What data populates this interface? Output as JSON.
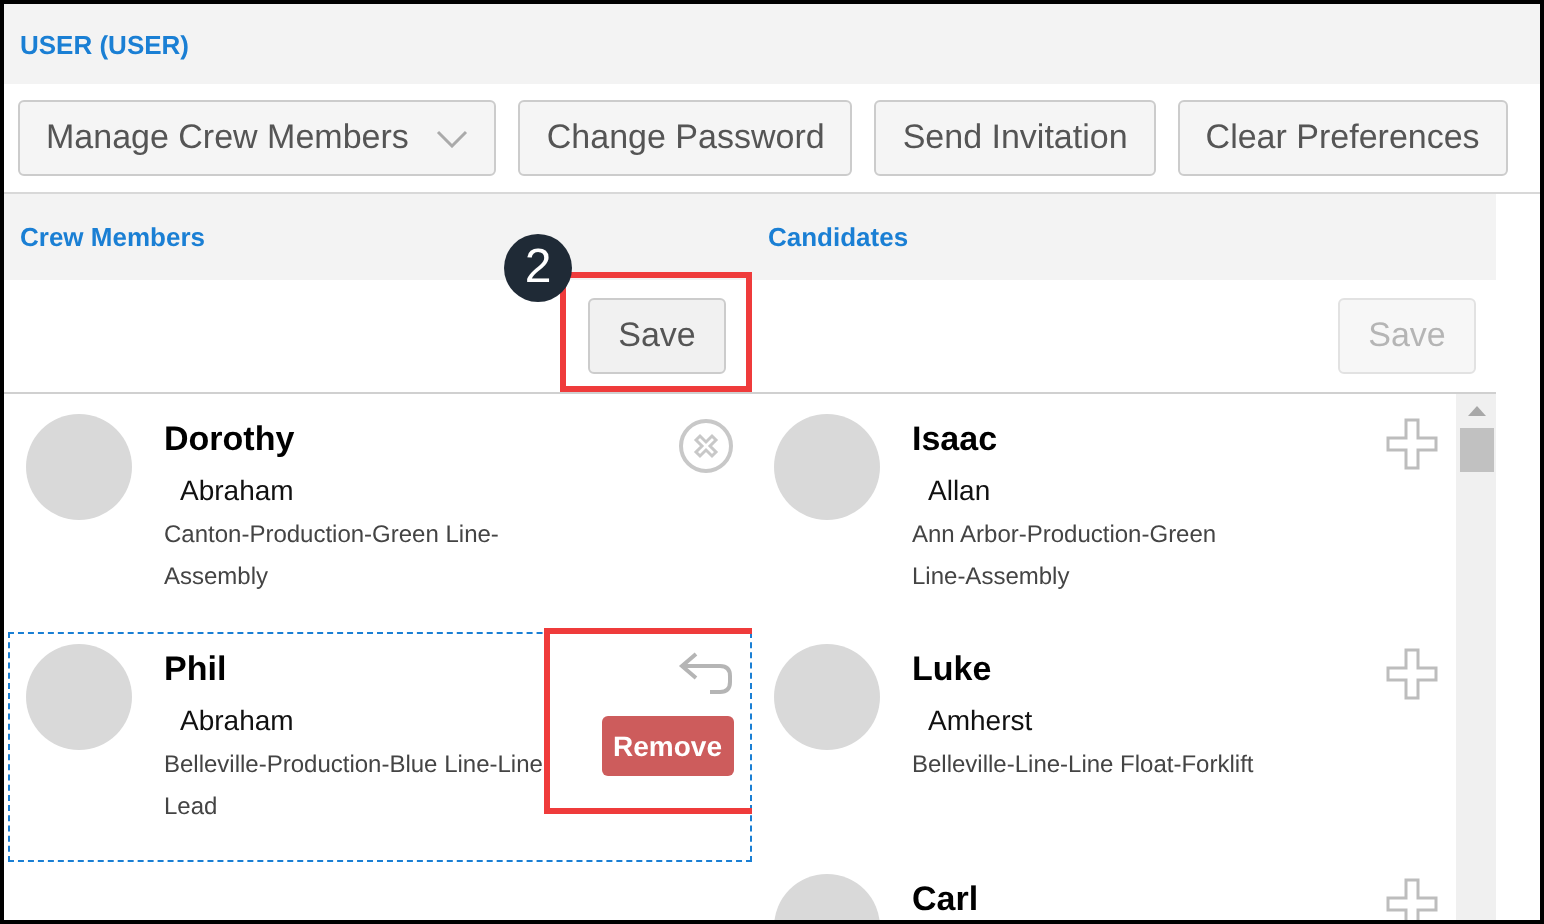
{
  "title": "USER (USER)",
  "toolbar": [
    {
      "kind": "dropdown",
      "label": "Manage Crew Members"
    },
    {
      "kind": "button",
      "label": "Change Password"
    },
    {
      "kind": "button",
      "label": "Send Invitation"
    },
    {
      "kind": "button",
      "label": "Clear Preferences"
    }
  ],
  "step_badge": "2",
  "crew_members": {
    "heading": "Crew Members",
    "save": {
      "label": "Save",
      "disabled": false,
      "highlighted": true
    },
    "items": [
      {
        "first_name": "Dorothy",
        "last_name": "Abraham",
        "location": "Canton-Production-Green Line-Assembly",
        "selected": false,
        "kind": "remove"
      },
      {
        "first_name": "Phil",
        "last_name": "Abraham",
        "location": "Belleville-Production-Blue Line-Line Lead",
        "selected": true,
        "kind": "pending",
        "button": "Remove",
        "highlighted": true
      }
    ]
  },
  "candidates": {
    "heading": "Candidates",
    "save": {
      "label": "Save",
      "disabled": true
    },
    "items": [
      {
        "first_name": "Isaac",
        "last_name": "Allan",
        "location": "Ann Arbor-Production-Green Line-Assembly"
      },
      {
        "first_name": "Luke",
        "last_name": "Amherst",
        "location": "Belleville-Line-Line Float-Forklift"
      },
      {
        "first_name": "Carl"
      }
    ]
  }
}
